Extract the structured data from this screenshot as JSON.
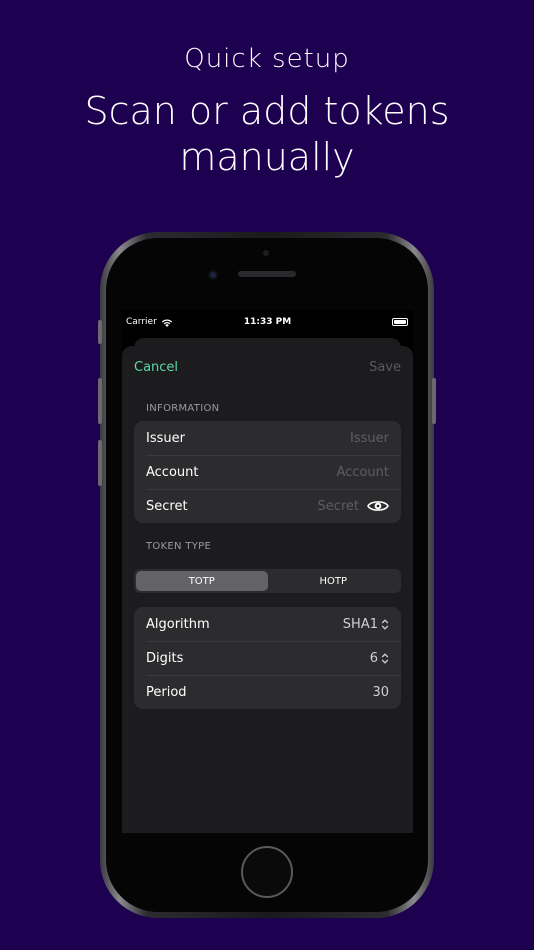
{
  "promo": {
    "subtitle": "Quick setup",
    "title": "Scan or add tokens manually"
  },
  "status_bar": {
    "carrier": "Carrier",
    "time": "11:33 PM"
  },
  "nav": {
    "cancel_label": "Cancel",
    "save_label": "Save"
  },
  "information": {
    "header": "INFORMATION",
    "rows": [
      {
        "label": "Issuer",
        "placeholder": "Issuer"
      },
      {
        "label": "Account",
        "placeholder": "Account"
      },
      {
        "label": "Secret",
        "placeholder": "Secret"
      }
    ]
  },
  "token_type": {
    "header": "TOKEN TYPE",
    "options": [
      "TOTP",
      "HOTP"
    ],
    "selected": "TOTP"
  },
  "settings": {
    "rows": [
      {
        "label": "Algorithm",
        "value": "SHA1"
      },
      {
        "label": "Digits",
        "value": "6"
      },
      {
        "label": "Period",
        "value": "30"
      }
    ]
  },
  "colors": {
    "background": "#1e0050",
    "accent": "#5ad8a6",
    "sheet": "#1c1c1e",
    "cell": "#2c2c2e"
  }
}
